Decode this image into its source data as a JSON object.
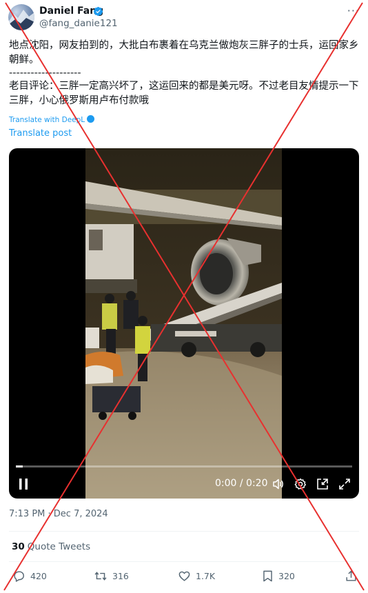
{
  "author": {
    "name": "Daniel Fang",
    "handle": "@fang_danie121",
    "verified": true
  },
  "menu": {
    "more_label": "···"
  },
  "post": {
    "line1": "地点沈阳，网友拍到的，大批白布裹着在乌克兰做炮灰三胖子的士兵，运回家乡朝鲜。",
    "separator": "--------------------",
    "line2": "老目评论：三胖一定高兴坏了，这运回来的都是美元呀。不过老目友情提示一下三胖，小心俄罗斯用卢布付款哦"
  },
  "translate": {
    "deepl_label": "Translate with DeepL",
    "post_label": "Translate post"
  },
  "video": {
    "time_display": "0:00 / 0:20",
    "progress_fraction": 0.02
  },
  "meta": {
    "timestamp": "7:13 PM · Dec 7, 2024"
  },
  "stats": {
    "quote_count": "30",
    "quote_label": "Quote Tweets"
  },
  "actions": {
    "replies": "420",
    "retweets": "316",
    "likes": "1.7K",
    "bookmarks": "320"
  },
  "colors": {
    "accent": "#1d9bf0",
    "text": "#0f1419",
    "secondary": "#536471",
    "overlay_cross": "#e8302f"
  }
}
